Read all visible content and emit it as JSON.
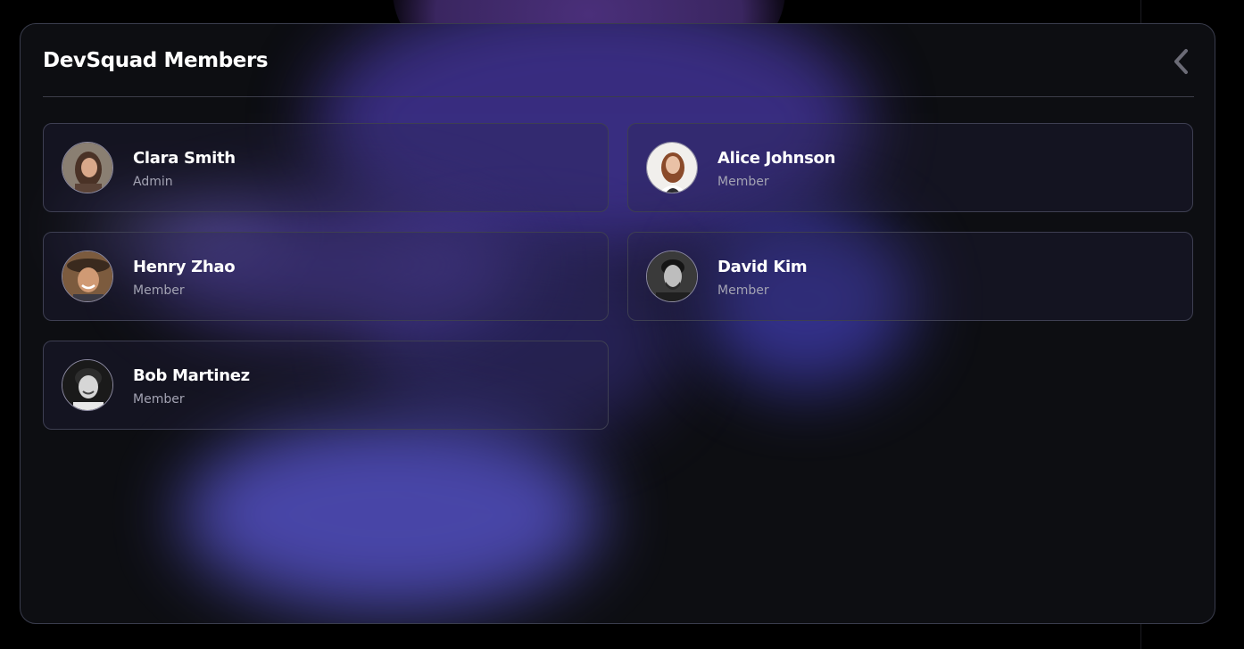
{
  "panel": {
    "title": "DevSquad Members",
    "back_icon": "chevron-left-icon"
  },
  "members": [
    {
      "name": "Clara Smith",
      "role": "Admin"
    },
    {
      "name": "Alice Johnson",
      "role": "Member"
    },
    {
      "name": "Henry Zhao",
      "role": "Member"
    },
    {
      "name": "David Kim",
      "role": "Member"
    },
    {
      "name": "Bob Martinez",
      "role": "Member"
    }
  ],
  "colors": {
    "background": "#000000",
    "panel": "#0d0e12",
    "accent_glow": "#4f4cb8",
    "text_primary": "#ffffff",
    "text_secondary": "#a3a3b3"
  }
}
